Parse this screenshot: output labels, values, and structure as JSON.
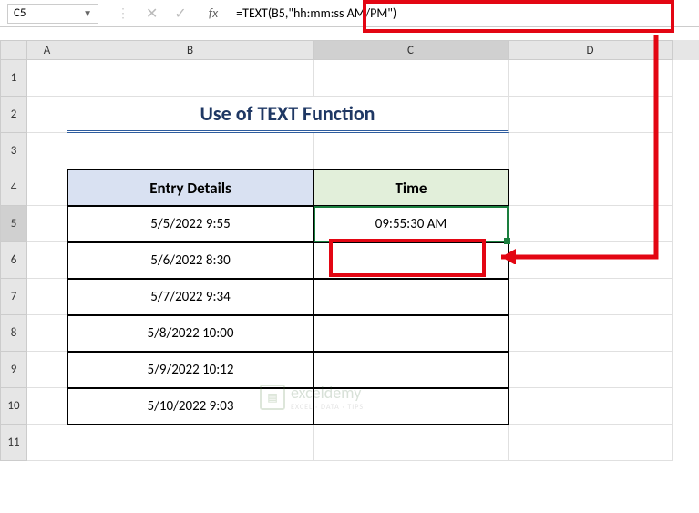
{
  "nameBox": {
    "value": "C5"
  },
  "formulaBar": {
    "formula": "=TEXT(B5,\"hh:mm:ss AM/PM\")"
  },
  "columns": [
    "A",
    "B",
    "C",
    "D"
  ],
  "rows": [
    "1",
    "2",
    "3",
    "4",
    "5",
    "6",
    "7",
    "8",
    "9",
    "10",
    "11"
  ],
  "title": "Use of TEXT Function",
  "headers": {
    "entry": "Entry Details",
    "time": "Time"
  },
  "data": [
    {
      "entry": "5/5/2022 9:55",
      "time": "09:55:30 AM"
    },
    {
      "entry": "5/6/2022 8:30",
      "time": ""
    },
    {
      "entry": "5/7/2022 9:34",
      "time": ""
    },
    {
      "entry": "5/8/2022 10:00",
      "time": ""
    },
    {
      "entry": "5/9/2022 10:12",
      "time": ""
    },
    {
      "entry": "5/10/2022 9:03",
      "time": ""
    }
  ],
  "watermark": {
    "title": "exceldemy",
    "sub": "EXCEL · DATA · TIPS"
  },
  "selectedCell": "C5",
  "selectedRow": "5",
  "selectedCol": "C"
}
